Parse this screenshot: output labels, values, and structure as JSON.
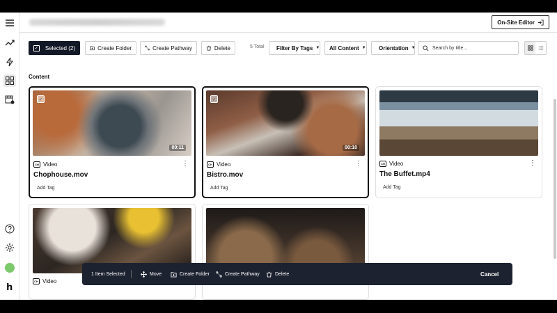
{
  "header": {
    "editor_button": "On-Site Editor"
  },
  "toolbar": {
    "selected_label": "Selected (2)",
    "create_folder": "Create Folder",
    "create_pathway": "Create Pathway",
    "delete": "Delete",
    "total": "5 Total",
    "filter_tags": "Filter By Tags",
    "content_filter": "All Content",
    "orientation": "Orientation",
    "search_placeholder": "Search by title..."
  },
  "section_label": "Content",
  "cards": [
    {
      "title": "Chophouse.mov",
      "type": "Video",
      "duration": "00:11",
      "add_tag": "Add Tag",
      "selected": true
    },
    {
      "title": "Bistro.mov",
      "type": "Video",
      "duration": "00:10",
      "add_tag": "Add Tag",
      "selected": true
    },
    {
      "title": "The Buffet.mp4",
      "type": "Video",
      "duration": "",
      "add_tag": "Add Tag",
      "selected": false
    },
    {
      "title": "",
      "type": "Video",
      "duration": "",
      "add_tag": "",
      "selected": false
    },
    {
      "title": "",
      "type": "",
      "duration": "",
      "add_tag": "",
      "selected": false
    }
  ],
  "action_bar": {
    "count": "1 Item Selected",
    "move": "Move",
    "create_folder": "Create Folder",
    "create_pathway": "Create Pathway",
    "delete": "Delete",
    "cancel": "Cancel"
  },
  "brand_letter": "h",
  "colors": {
    "primary_dark": "#121826",
    "action_bar": "#1d2230",
    "avatar": "#7cc96b"
  }
}
